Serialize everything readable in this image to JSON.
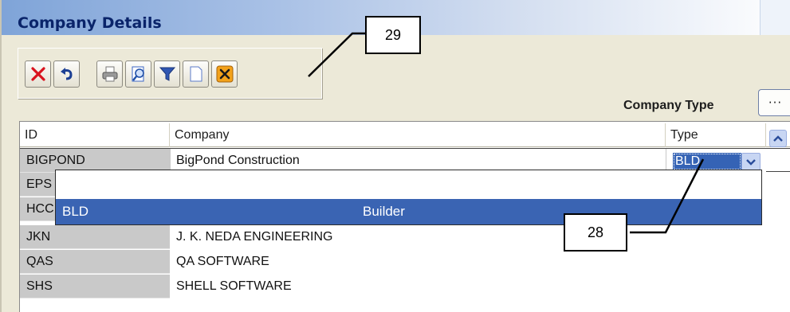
{
  "window": {
    "title": "Company Details"
  },
  "toolbar": {
    "buttons": [
      {
        "name": "delete",
        "icon": "red-x-icon"
      },
      {
        "name": "undo",
        "icon": "undo-arrow-icon"
      },
      {
        "name": "print",
        "icon": "printer-icon"
      },
      {
        "name": "find",
        "icon": "magnifier-icon"
      },
      {
        "name": "filter",
        "icon": "funnel-icon"
      },
      {
        "name": "new",
        "icon": "blank-page-icon"
      },
      {
        "name": "close",
        "icon": "orange-x-icon"
      }
    ]
  },
  "company_type": {
    "label": "Company Type",
    "button_label": "···"
  },
  "grid": {
    "headers": {
      "id": "ID",
      "company": "Company",
      "type": "Type"
    },
    "rows": [
      {
        "id": "BIGPOND",
        "company": "BigPond Construction",
        "type": "BLD"
      },
      {
        "id": "EPS",
        "company": ""
      },
      {
        "id": "HCC",
        "company": ""
      },
      {
        "id": "JKN",
        "company": "J. K. NEDA ENGINEERING"
      },
      {
        "id": "QAS",
        "company": "QA SOFTWARE"
      },
      {
        "id": "SHS",
        "company": "SHELL SOFTWARE"
      }
    ]
  },
  "dropdown": {
    "selected": {
      "code": "BLD",
      "description": "Builder"
    }
  },
  "callouts": {
    "a": "29",
    "b": "28"
  },
  "colors": {
    "selection": "#3a64b3",
    "title_text": "#0a246a"
  }
}
